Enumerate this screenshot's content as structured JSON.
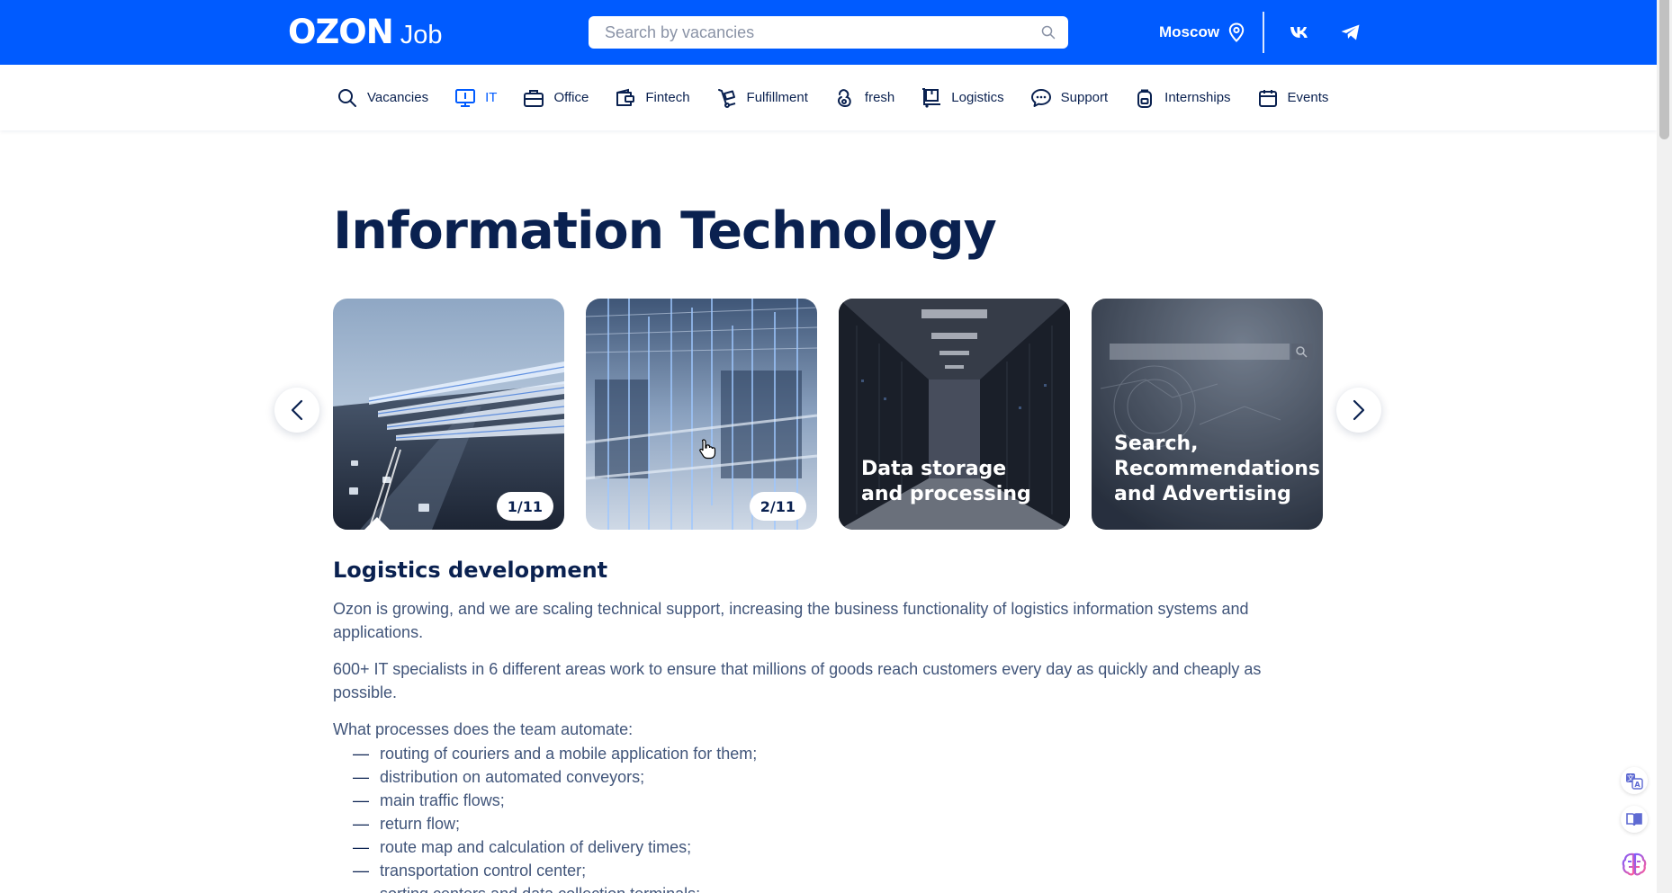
{
  "header": {
    "logo_brand": "OZON",
    "logo_suffix": "Job",
    "search_placeholder": "Search by vacancies",
    "city": "Moscow",
    "icons": {
      "search": "search-icon",
      "pin": "location-pin-icon",
      "vk": "vk-icon",
      "telegram": "telegram-icon"
    }
  },
  "nav": {
    "items": [
      {
        "label": "Vacancies",
        "icon": "search-icon"
      },
      {
        "label": "IT",
        "icon": "monitor-icon",
        "active": true
      },
      {
        "label": "Office",
        "icon": "briefcase-icon"
      },
      {
        "label": "Fintech",
        "icon": "wallet-icon"
      },
      {
        "label": "Fulfillment",
        "icon": "hand-truck-icon"
      },
      {
        "label": "fresh",
        "icon": "fresh-icon"
      },
      {
        "label": "Logistics",
        "icon": "logistics-icon"
      },
      {
        "label": "Support",
        "icon": "chat-icon"
      },
      {
        "label": "Internships",
        "icon": "backpack-icon"
      },
      {
        "label": "Events",
        "icon": "calendar-icon"
      }
    ]
  },
  "page": {
    "title": "Information Technology"
  },
  "carousel": {
    "cards": [
      {
        "counter": "1/11",
        "caption": "",
        "selected": true
      },
      {
        "counter": "2/11",
        "caption": ""
      },
      {
        "counter": "",
        "caption": "Data storage and processing"
      },
      {
        "counter": "",
        "caption": "Search, Recommendations and Advertising"
      }
    ],
    "icons": {
      "prev": "chevron-left-icon",
      "next": "chevron-right-icon"
    }
  },
  "content": {
    "section_title": "Logistics development",
    "paragraph_1": "Ozon is growing, and we are scaling technical support, increasing the business functionality of logistics information systems and applications.",
    "paragraph_2": "600+ IT specialists in 6 different areas work to ensure that millions of goods reach customers every day as quickly and cheaply as possible.",
    "processes_intro": "What processes does the team automate:",
    "dash": "—",
    "processes": [
      "routing of couriers and a mobile application for them;",
      "distribution on automated conveyors;",
      "main traffic flows;",
      "return flow;",
      "route map and calculation of delivery times;",
      "transportation control center;",
      "sorting centers and data collection terminals;"
    ]
  },
  "side_tools": [
    {
      "icon": "translate-icon"
    },
    {
      "icon": "book-icon"
    },
    {
      "icon": "brain-icon"
    }
  ],
  "colors": {
    "brand_blue": "#005bff",
    "heading_navy": "#0a2150",
    "body_text": "#41557a"
  }
}
